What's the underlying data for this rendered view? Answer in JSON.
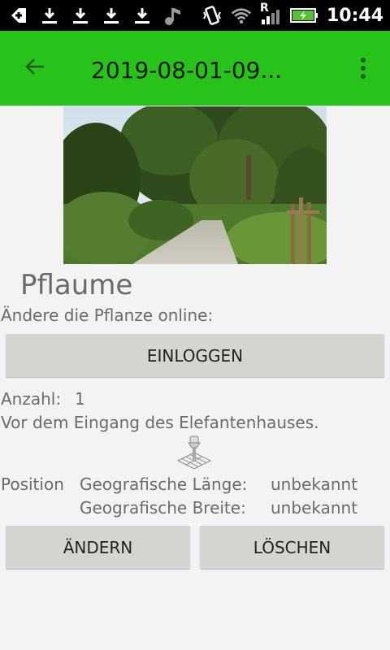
{
  "status_bar": {
    "time": "10:44",
    "icons": [
      "gmail-icon",
      "download-icon",
      "download-icon",
      "download-icon",
      "download-icon",
      "music-icon",
      "vibrate-icon",
      "wifi-icon",
      "signal-roaming-icon",
      "battery-charging-icon"
    ],
    "roaming_indicator": "R"
  },
  "toolbar": {
    "title": "2019-08-01-09...",
    "back_icon": "arrow-left-icon",
    "menu_icon": "more-vert-icon",
    "color": "#27c21a"
  },
  "plant": {
    "name": "Pflaume",
    "online_label": "Ändere die Pflanze online:",
    "login_button": "EINLOGGEN",
    "count_label": "Anzahl:",
    "count_value": "1",
    "description": "Vor dem Eingang des Elefantenhauses."
  },
  "position": {
    "label": "Position",
    "longitude_label": "Geografische Länge:",
    "longitude_value": "unbekannt",
    "latitude_label": "Geografische Breite:",
    "latitude_value": "unbekannt"
  },
  "actions": {
    "edit_button": "ÄNDERN",
    "delete_button": "LÖSCHEN"
  }
}
